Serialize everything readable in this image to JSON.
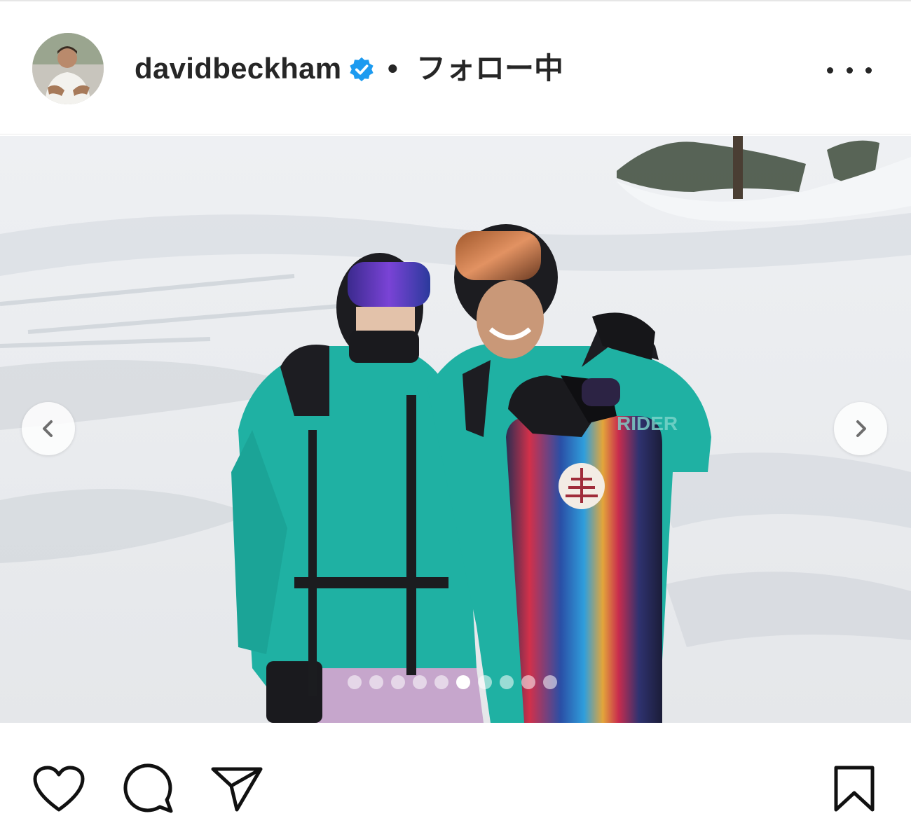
{
  "post": {
    "username": "davidbeckham",
    "separator": "•",
    "follow_status": "フォロー中",
    "verified": true,
    "verified_color": "#1d9bf0"
  },
  "header_icons": {
    "avatar": "avatar",
    "verified": "verified-badge-icon",
    "more": "more-options-icon"
  },
  "carousel": {
    "total_slides": 10,
    "active_index": 5,
    "prev_icon": "chevron-left-icon",
    "next_icon": "chevron-right-icon"
  },
  "actions": {
    "like_icon": "heart-icon",
    "comment_icon": "comment-icon",
    "share_icon": "send-icon",
    "save_icon": "bookmark-icon"
  },
  "colors": {
    "text": "#262626",
    "jacket": "#1fb1a3"
  }
}
